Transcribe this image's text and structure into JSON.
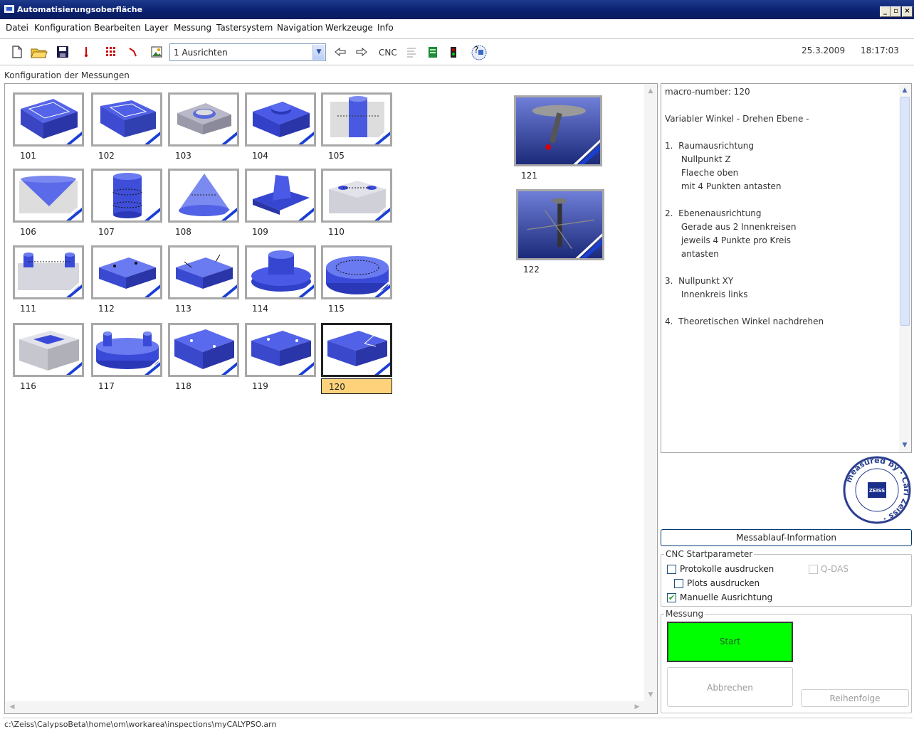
{
  "window": {
    "title": "Automatisierungsoberfläche",
    "controls": [
      "_",
      "▫",
      "×"
    ]
  },
  "menu": [
    "Datei",
    "Konfiguration",
    "Bearbeiten",
    "Layer",
    "Messung",
    "Tastersystem",
    "Navigation",
    "Werkzeuge",
    "Info"
  ],
  "toolbar": {
    "combo_value": "1 Ausrichten",
    "cnc_label": "CNC",
    "date": "25.3.2009",
    "time": "18:17:03"
  },
  "section_label": "Konfiguration der Messungen",
  "thumbnails": [
    {
      "num": "101"
    },
    {
      "num": "102"
    },
    {
      "num": "103"
    },
    {
      "num": "104"
    },
    {
      "num": "105"
    },
    {
      "num": "106"
    },
    {
      "num": "107"
    },
    {
      "num": "108"
    },
    {
      "num": "109"
    },
    {
      "num": "110"
    },
    {
      "num": "111"
    },
    {
      "num": "112"
    },
    {
      "num": "113"
    },
    {
      "num": "114"
    },
    {
      "num": "115"
    },
    {
      "num": "116"
    },
    {
      "num": "117"
    },
    {
      "num": "118"
    },
    {
      "num": "119"
    },
    {
      "num": "120"
    },
    {
      "num": "121"
    },
    {
      "num": "122"
    }
  ],
  "selected_macro": "120",
  "info": {
    "lines": [
      "macro-number: 120",
      "",
      "Variabler Winkel - Drehen Ebene -",
      "",
      "1.  Raumausrichtung",
      "      Nullpunkt Z",
      "      Flaeche oben",
      "      mit 4 Punkten antasten",
      "",
      "2.  Ebenenausrichtung",
      "      Gerade aus 2 Innenkreisen",
      "      jeweils 4 Punkte pro Kreis",
      "      antasten",
      "",
      "3.  Nullpunkt XY",
      "      Innenkreis links",
      "",
      "4.  Theoretischen Winkel nachdrehen"
    ]
  },
  "seal": {
    "ring_text": "measured by Carl Zeiss",
    "center": "ZEISS"
  },
  "info_button": "Messablauf-Information",
  "cnc": {
    "title": "CNC Startparameter",
    "protokolle": "Protokolle ausdrucken",
    "plots": "Plots ausdrucken",
    "manuelle": "Manuelle Ausrichtung",
    "qdas": "Q-DAS"
  },
  "messung": {
    "title": "Messung",
    "start": "Start",
    "abort": "Abbrechen",
    "order": "Reihenfolge"
  },
  "status_path": "c:\\Zeiss\\CalypsoBeta\\home\\om\\workarea\\inspections\\myCALYPSO.arn",
  "colors": {
    "accent": "#0a246a",
    "start_green": "#00ff00",
    "selected_label": "#fdd27a"
  }
}
